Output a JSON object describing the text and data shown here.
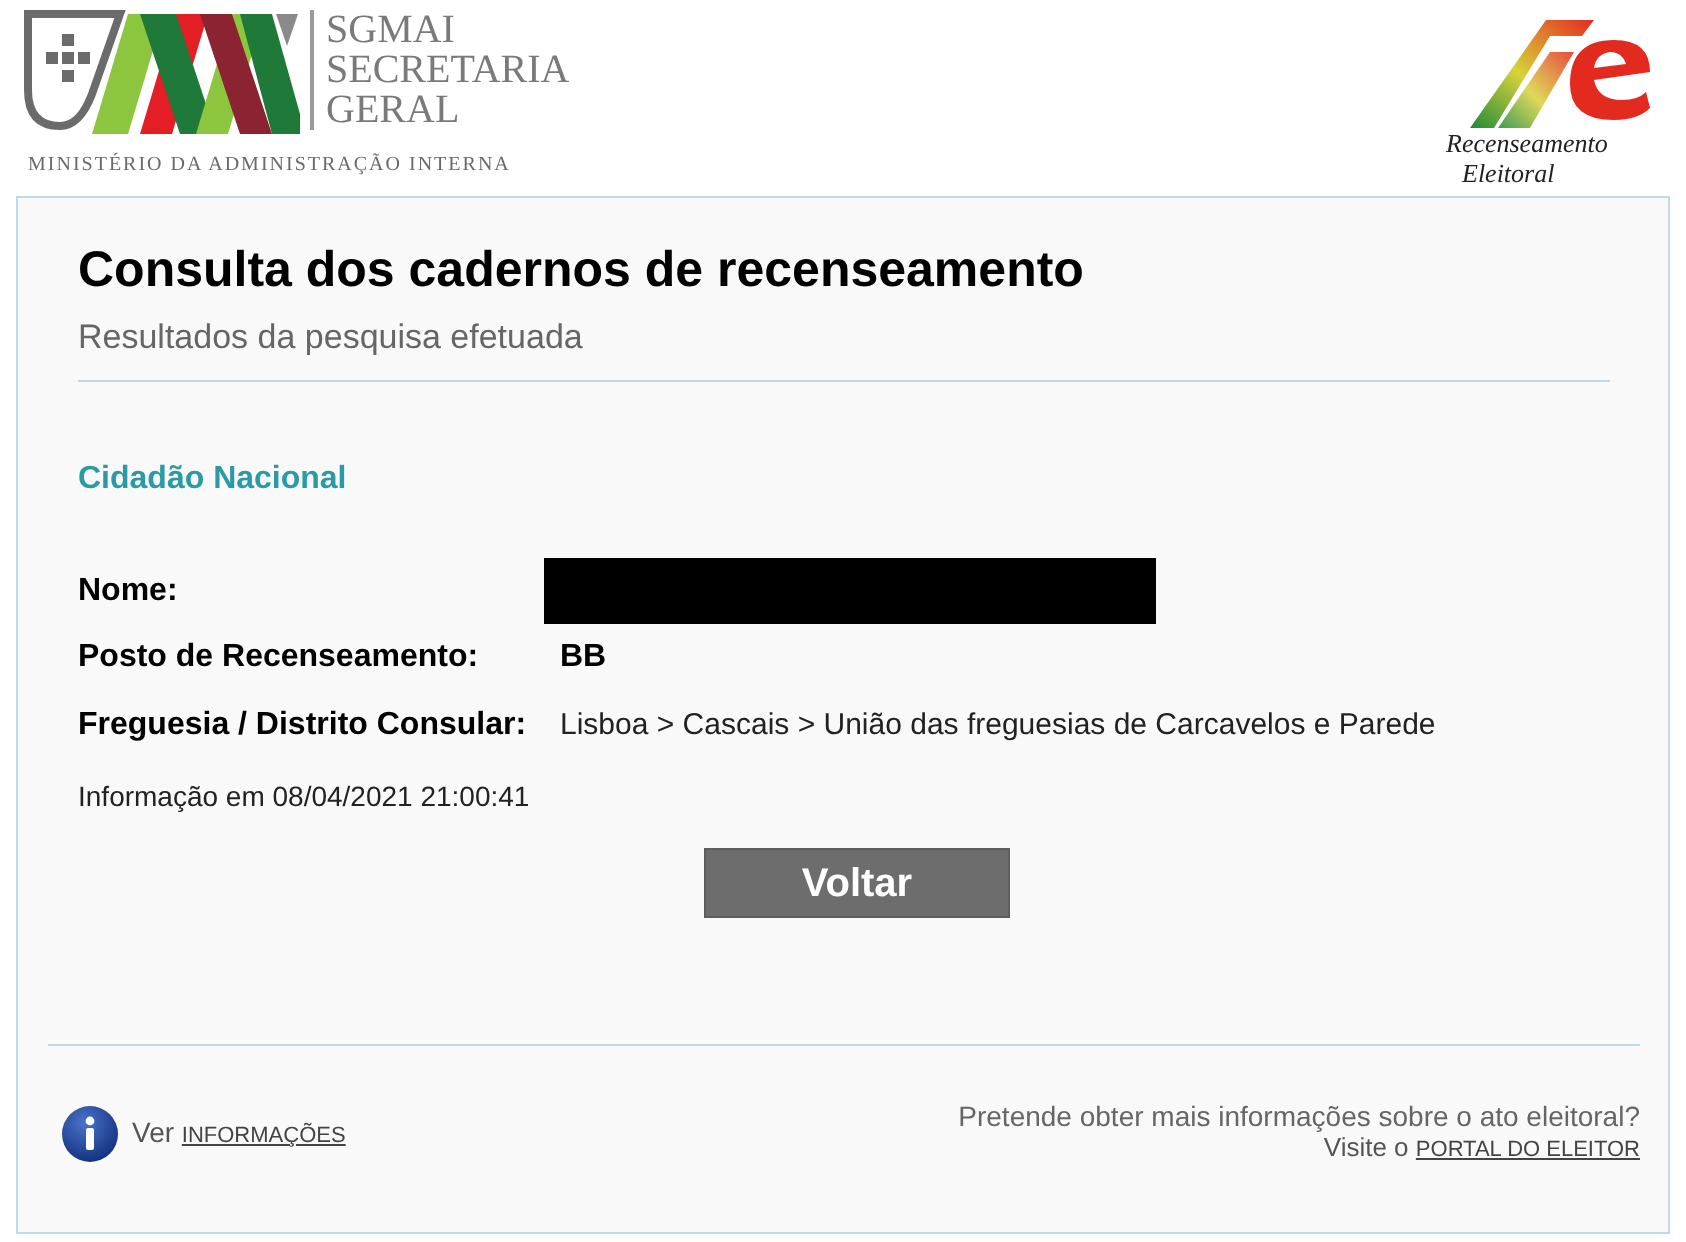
{
  "header": {
    "ministry_logo": {
      "acronym": "SGMAI",
      "name_lines": [
        "SECRETARIA",
        "GERAL"
      ],
      "ministry": "MINISTÉRIO DA ADMINISTRAÇÃO INTERNA"
    },
    "election_logo": {
      "lines": [
        "Recenseamento",
        "Eleitoral"
      ]
    }
  },
  "page": {
    "title": "Consulta dos cadernos de recenseamento",
    "subtitle": "Resultados da pesquisa efetuada"
  },
  "section": {
    "title": "Cidadão Nacional",
    "fields": [
      {
        "kind": "redacted",
        "label": "Nome:"
      },
      {
        "kind": "strong",
        "label": "Posto de Recenseamento:",
        "value": "BB"
      },
      {
        "kind": "text",
        "label": "Freguesia / Distrito Consular:",
        "value": "Lisboa > Cascais > União das freguesias de Carcavelos e Parede"
      }
    ],
    "timestamp": "Informação em 08/04/2021 21:00:41"
  },
  "back_button": "Voltar",
  "footer": {
    "info": {
      "prefix": "Ver",
      "link": "INFORMAÇÕES"
    },
    "portal": {
      "question": "Pretende obter mais informações sobre o ato eleitoral?",
      "prefix": "Visite o",
      "link": "PORTAL DO ELEITOR"
    }
  }
}
